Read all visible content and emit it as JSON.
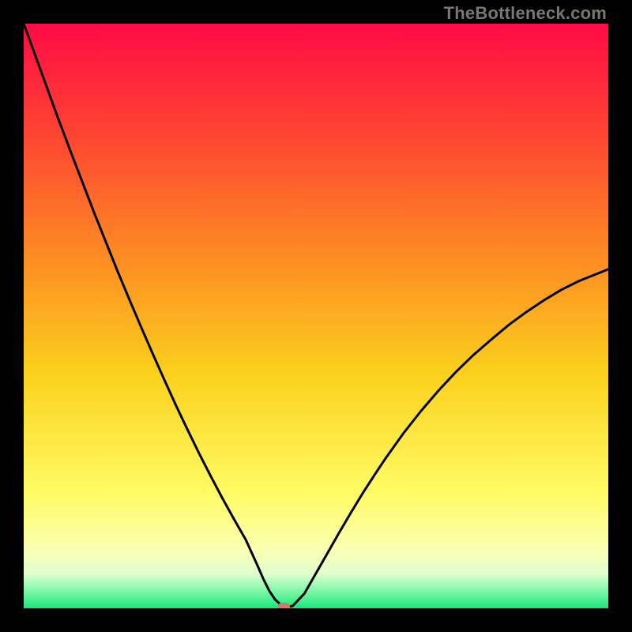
{
  "watermark": "TheBottleneck.com",
  "chart_data": {
    "type": "line",
    "title": "",
    "xlabel": "",
    "ylabel": "",
    "xlim": [
      0,
      100
    ],
    "ylim": [
      0,
      100
    ],
    "x": [
      0,
      2,
      4,
      6,
      8,
      10,
      12,
      14,
      16,
      18,
      20,
      22,
      24,
      26,
      28,
      30,
      32,
      34,
      36,
      38,
      40,
      41,
      42,
      43,
      44,
      45,
      46,
      48,
      50,
      52,
      54,
      56,
      58,
      60,
      62,
      65,
      68,
      71,
      74,
      77,
      80,
      83,
      86,
      89,
      92,
      95,
      98,
      100
    ],
    "values": [
      100,
      94.5,
      89.0,
      83.5,
      78.2,
      73.0,
      67.8,
      62.8,
      57.8,
      53.0,
      48.3,
      43.7,
      39.2,
      34.8,
      30.6,
      26.5,
      22.6,
      18.8,
      15.2,
      11.7,
      7.3,
      5.0,
      3.0,
      1.5,
      0.6,
      0.2,
      0.4,
      2.5,
      6.0,
      9.5,
      13.0,
      16.4,
      19.7,
      22.8,
      25.8,
      30.0,
      33.8,
      37.3,
      40.5,
      43.4,
      46.0,
      48.5,
      50.7,
      52.7,
      54.5,
      56.0,
      57.2,
      58.0
    ],
    "marker": {
      "x": 44.5,
      "y": 0.0
    },
    "gradient_stops": [
      {
        "pct": 0,
        "color": "#ff0a45"
      },
      {
        "pct": 20,
        "color": "#ff4830"
      },
      {
        "pct": 40,
        "color": "#fc8c23"
      },
      {
        "pct": 60,
        "color": "#fbd11c"
      },
      {
        "pct": 80,
        "color": "#fffb63"
      },
      {
        "pct": 90,
        "color": "#fbffb2"
      },
      {
        "pct": 94,
        "color": "#e0ffcf"
      },
      {
        "pct": 97,
        "color": "#80f8a8"
      },
      {
        "pct": 100,
        "color": "#17e87a"
      }
    ],
    "stroke_color": "#000000",
    "marker_color": "#d07a6e"
  }
}
